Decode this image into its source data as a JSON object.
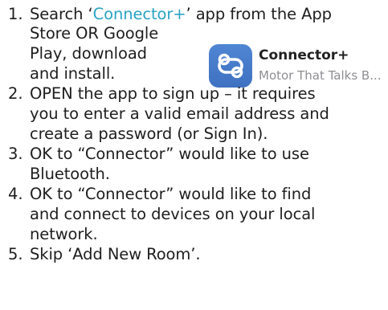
{
  "steps": [
    {
      "number": "1.",
      "lines": [
        {
          "before": "Search ‘",
          "accent": "Connector+",
          "after": "’ app from the App"
        },
        {
          "text": "Store OR Google"
        },
        {
          "text": "Play, download"
        },
        {
          "text": "and install."
        }
      ]
    },
    {
      "number": "2.",
      "lines": [
        {
          "text": "OPEN the app to sign up – it requires"
        },
        {
          "text": "you to enter a valid email address and"
        },
        {
          "text": "create a password (or Sign In)."
        }
      ]
    },
    {
      "number": "3.",
      "lines": [
        {
          "text": "OK to “Connector” would like to use"
        },
        {
          "text": "Bluetooth."
        }
      ]
    },
    {
      "number": "4.",
      "lines": [
        {
          "text": "OK to “Connector” would like to find"
        },
        {
          "text": "and connect to devices on your local"
        },
        {
          "text": "network."
        }
      ]
    },
    {
      "number": "5.",
      "lines": [
        {
          "text": "Skip ‘Add New Room’."
        }
      ]
    }
  ],
  "app_badge": {
    "name": "Connector+",
    "tagline": "Motor That Talks B...",
    "icon": "connector-link-icon",
    "icon_color": "#4a7fcf"
  },
  "colors": {
    "accent": "#2aa3c4",
    "text": "#1e1e1e"
  }
}
